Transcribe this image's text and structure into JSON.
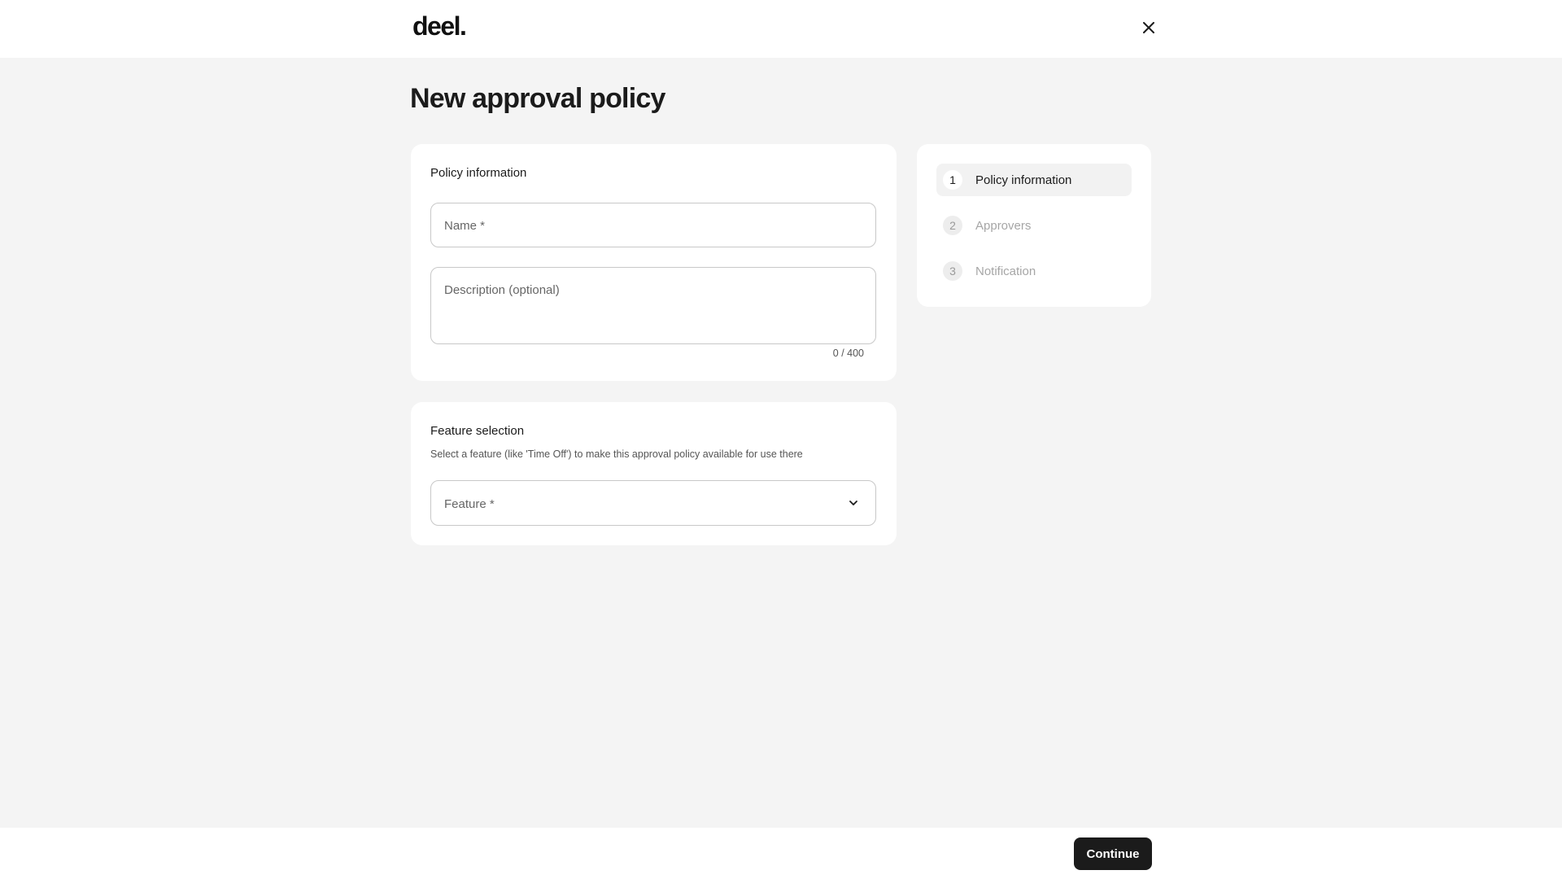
{
  "header": {
    "logo_text": "deel.",
    "close_icon": "close-icon"
  },
  "page": {
    "title": "New approval policy"
  },
  "policy_info": {
    "title": "Policy information",
    "name_placeholder": "Name *",
    "description_placeholder": "Description (optional)",
    "counter": "0 / 400"
  },
  "feature_selection": {
    "title": "Feature selection",
    "subtitle": "Select a feature (like 'Time Off') to make this approval policy available for use there",
    "feature_placeholder": "Feature *",
    "chevron_icon": "chevron-down-icon"
  },
  "steps": [
    {
      "number": "1",
      "label": "Policy information",
      "active": true
    },
    {
      "number": "2",
      "label": "Approvers",
      "active": false
    },
    {
      "number": "3",
      "label": "Notification",
      "active": false
    }
  ],
  "footer": {
    "continue_label": "Continue"
  },
  "colors": {
    "background": "#f4f4f4",
    "card": "#ffffff",
    "primary_button": "#1b1b1b",
    "inactive_text": "#a6a6a6"
  }
}
